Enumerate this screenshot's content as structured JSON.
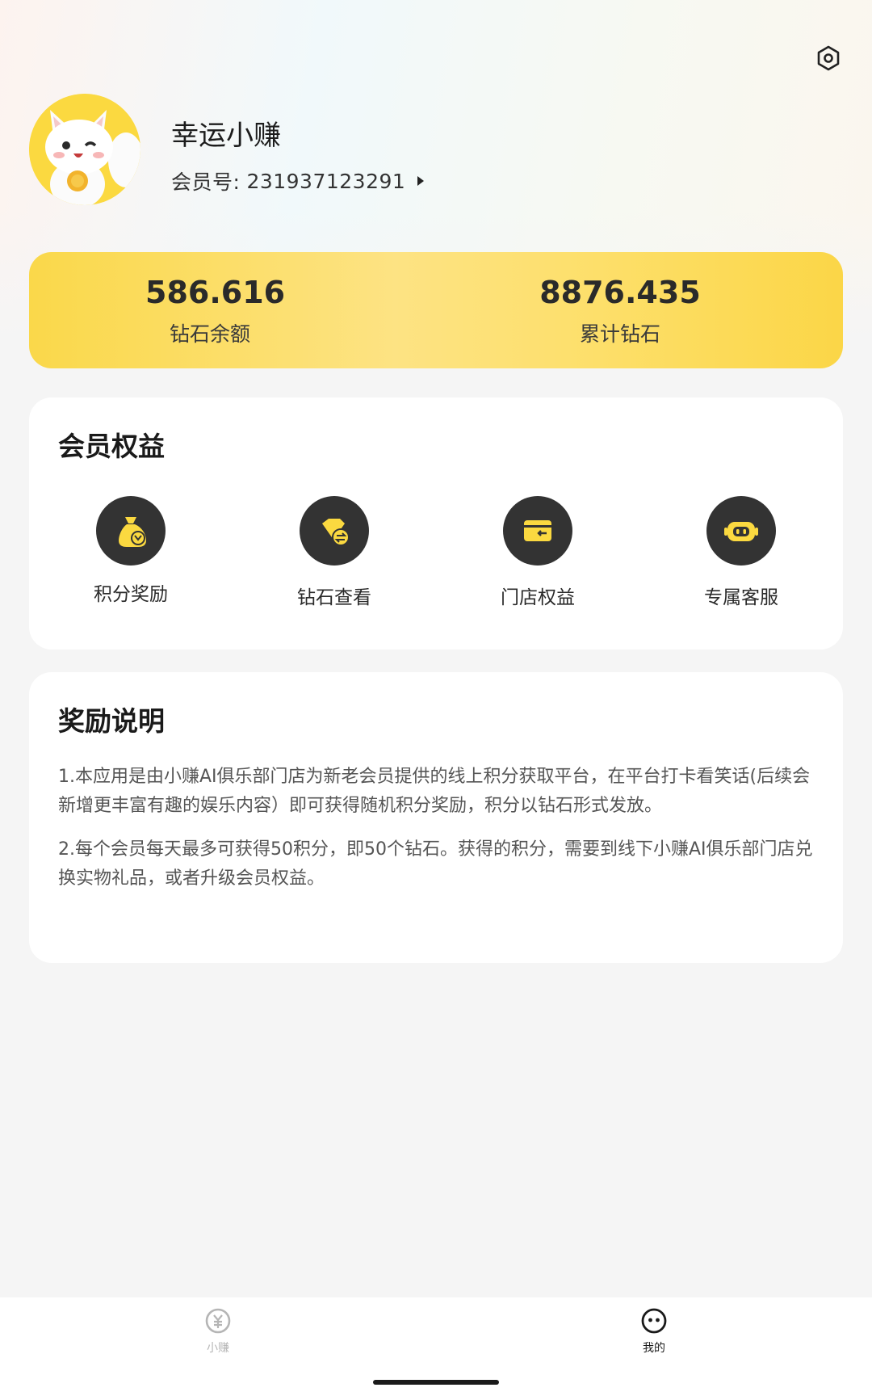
{
  "header": {
    "username": "幸运小赚",
    "member_label": "会员号:",
    "member_id": "231937123291"
  },
  "stats": [
    {
      "value": "586.616",
      "label": "钻石余额"
    },
    {
      "value": "8876.435",
      "label": "累计钻石"
    }
  ],
  "benefits": {
    "title": "会员权益",
    "items": [
      {
        "label": "积分奖励",
        "icon": "money-bag-icon"
      },
      {
        "label": "钻石查看",
        "icon": "diamond-exchange-icon"
      },
      {
        "label": "门店权益",
        "icon": "wallet-icon"
      },
      {
        "label": "专属客服",
        "icon": "robot-icon"
      }
    ]
  },
  "rewards": {
    "title": "奖励说明",
    "paragraphs": [
      "1.本应用是由小赚AI俱乐部门店为新老会员提供的线上积分获取平台，在平台打卡看笑话(后续会新增更丰富有趣的娱乐内容）即可获得随机积分奖励，积分以钻石形式发放。",
      "2.每个会员每天最多可获得50积分，即50个钻石。获得的积分，需要到线下小赚AI俱乐部门店兑换实物礼品，或者升级会员权益。"
    ]
  },
  "nav": {
    "items": [
      {
        "label": "小赚",
        "icon": "yuan-coin-icon",
        "active": false
      },
      {
        "label": "我的",
        "icon": "smiley-face-icon",
        "active": true
      }
    ]
  },
  "colors": {
    "accent_yellow": "#fbd940",
    "icon_dark": "#333333",
    "nav_inactive": "#b5b5b5",
    "nav_active": "#1a1a1a"
  }
}
